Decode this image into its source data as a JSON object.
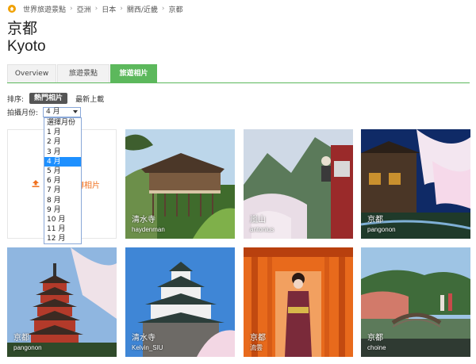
{
  "breadcrumb": {
    "items": [
      "世界旅遊景點",
      "亞洲",
      "日本",
      "關西/近畿",
      "京都"
    ],
    "separator": "›"
  },
  "title": {
    "zh": "京都",
    "en": "Kyoto"
  },
  "tabs": [
    {
      "label": "Overview",
      "active": false
    },
    {
      "label": "旅遊景點",
      "active": false
    },
    {
      "label": "旅遊相片",
      "active": true
    }
  ],
  "accent_color": "#5cb85c",
  "sort": {
    "label": "排序:",
    "options": [
      "熱門相片",
      "最新上載"
    ],
    "selected": "熱門相片"
  },
  "month": {
    "label": "拍攝月份:",
    "selected": "4 月",
    "options": [
      "選擇月份",
      "1 月",
      "2 月",
      "3 月",
      "4 月",
      "5 月",
      "6 月",
      "7 月",
      "8 月",
      "9 月",
      "10 月",
      "11 月",
      "12 月"
    ]
  },
  "upload": {
    "label": "上傳相片",
    "icon": "upload-icon",
    "visible_text": "片"
  },
  "photos": [
    {
      "place": "清水寺",
      "user": "haydenman"
    },
    {
      "place": "嵐山",
      "user": "antonius"
    },
    {
      "place": "京都",
      "user": "pangonon"
    },
    {
      "place": "京都",
      "user": "pangonon"
    },
    {
      "place": "清水寺",
      "user": "Kelvin_SIU"
    },
    {
      "place": "京都",
      "user": "流雲"
    },
    {
      "place": "京都",
      "user": "choine"
    }
  ]
}
